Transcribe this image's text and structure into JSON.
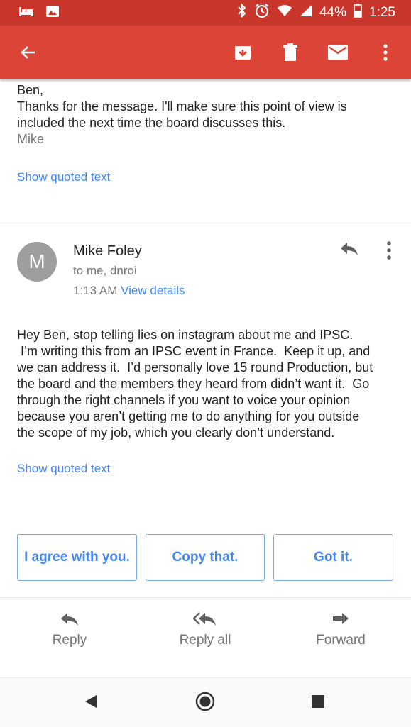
{
  "status_bar": {
    "battery": "44%",
    "time": "1:25",
    "icons": [
      "bed-icon",
      "image-icon",
      "bluetooth-icon",
      "alarm-icon",
      "wifi-icon",
      "signal-icon",
      "battery-icon"
    ]
  },
  "toolbar": {
    "icons": [
      "back-arrow-icon",
      "archive-icon",
      "delete-icon",
      "mark-unread-icon",
      "more-vert-icon"
    ],
    "color": "#db4437"
  },
  "message_prev": {
    "lines": [
      "Ben,",
      "Thanks for the message.  I'll make sure this point of view is",
      "included the next time the board discusses this."
    ],
    "signature": "Mike",
    "show_quoted": "Show quoted text"
  },
  "message_main": {
    "avatar_letter": "M",
    "sender": "Mike Foley",
    "recipients": "to me, dnroi",
    "time": "1:13 AM",
    "view_details": "View details",
    "lines": [
      "Hey Ben, stop telling lies on instagram about me and IPSC.",
      " I’m writing this from an IPSC event in France.  Keep it up, and",
      "we can address it.  I’d personally love 15 round Production, but",
      "the board and the members they heard from didn’t want it.  Go",
      "through the right channels if you want to voice your opinion",
      "because you aren’t getting me to do anything for you outside",
      "the scope of my job, which you clearly don’t understand."
    ],
    "show_quoted": "Show quoted text"
  },
  "smart_replies": [
    "I agree with you.",
    "Copy that.",
    "Got it."
  ],
  "footer": {
    "reply": "Reply",
    "reply_all": "Reply all",
    "forward": "Forward"
  },
  "accent": "#4285f4"
}
